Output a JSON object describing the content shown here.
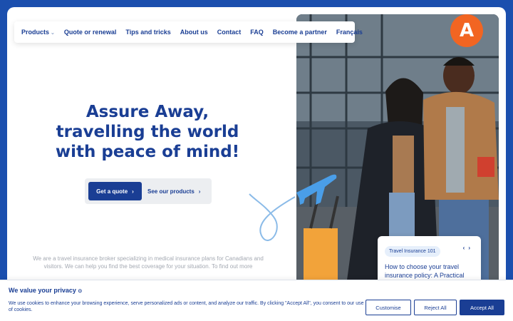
{
  "nav": {
    "items": [
      {
        "label": "Products",
        "dropdown": true
      },
      {
        "label": "Quote or renewal"
      },
      {
        "label": "Tips and tricks"
      },
      {
        "label": "About us"
      },
      {
        "label": "Contact"
      },
      {
        "label": "FAQ"
      },
      {
        "label": "Become a partner"
      },
      {
        "label": "Français"
      }
    ]
  },
  "logo": {
    "letter": "A",
    "color": "#f26522"
  },
  "hero": {
    "line1": "Assure Away,",
    "line2": "travelling the world",
    "line3": "with peace of mind!",
    "primary_cta": "Get a quote",
    "secondary_cta": "See our products",
    "intro": "We are a travel insurance broker specializing in medical insurance plans for Canadians and visitors. We can help you find the best coverage for your situation. To find out more"
  },
  "card": {
    "tag": "Travel Insurance 101",
    "title": "How to choose your travel insurance policy: A Practical"
  },
  "cookie": {
    "title": "We value your privacy",
    "text": "We use cookies to enhance your browsing experience, serve personalized ads or content, and analyze our traffic. By clicking \"Accept All\", you consent to our use of cookies.",
    "customise": "Customise",
    "reject": "Reject All",
    "accept": "Accept All"
  },
  "colors": {
    "brand": "#1a3e94",
    "frame": "#1b4fae",
    "accent": "#f26522",
    "plane": "#4a9ee8"
  },
  "icons": [
    "chevron-down-icon",
    "chevron-right-icon",
    "airplane-icon",
    "chevron-left-icon"
  ]
}
